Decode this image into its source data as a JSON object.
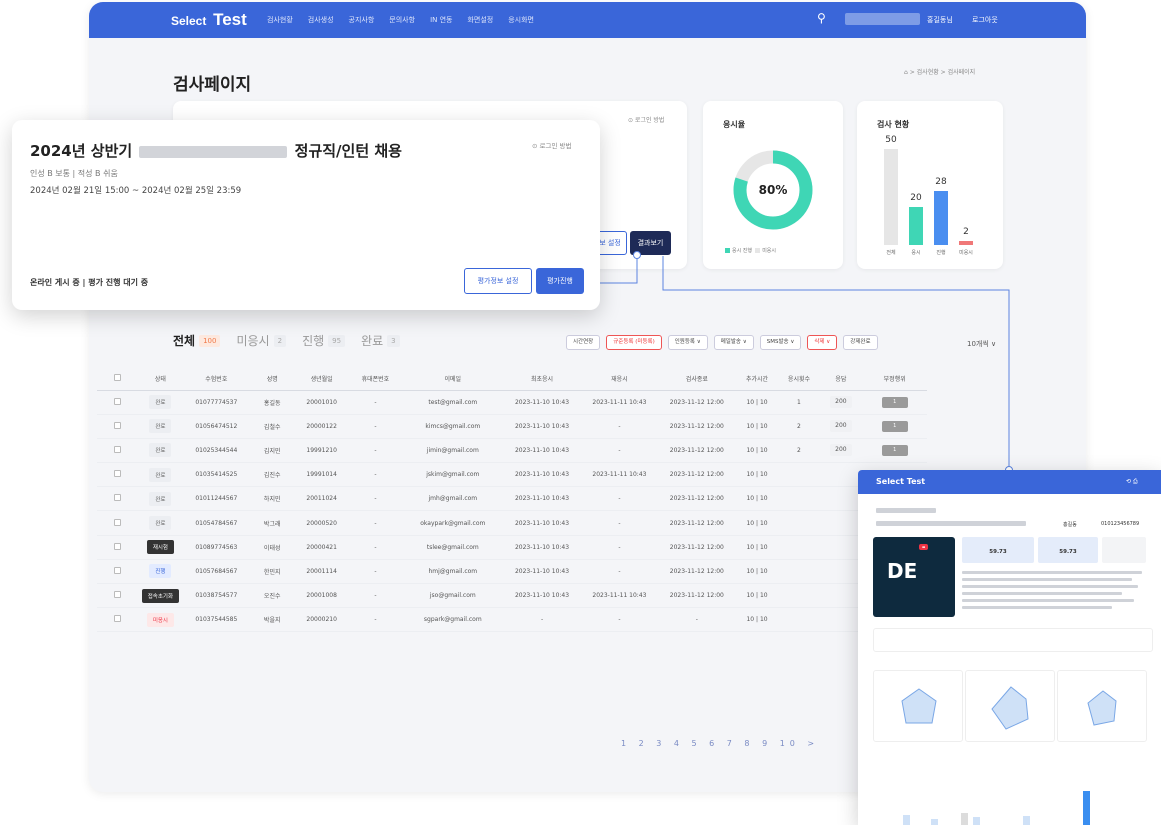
{
  "nav": {
    "brand_select": "Select",
    "brand_test": "Test",
    "menu": [
      "검사현황",
      "검사생성",
      "공지사항",
      "문의사항",
      "IN 연동",
      "화면설정",
      "응시화면"
    ],
    "user": "홍길동님",
    "logout": "로그아웃"
  },
  "page": {
    "title": "검사페이지",
    "breadcrumb": "⌂ > 검사현황 > 검사페이지"
  },
  "back_card": {
    "login_method": "⊙ 로그인 방법",
    "setting": "보 설정",
    "result": "결과보기"
  },
  "rate_card": {
    "title": "응시율",
    "percent": "80%",
    "legend_done": "응시 진행",
    "legend_not": "미응시",
    "value": 80
  },
  "status_card": {
    "title": "검사 현황"
  },
  "chart_data": {
    "type": "bar",
    "categories": [
      "전체",
      "응시",
      "진행",
      "미응시"
    ],
    "values": [
      50,
      20,
      28,
      2
    ],
    "colors": [
      "#e6e6e6",
      "#3fd6b5",
      "#4a8ef0",
      "#f07878"
    ]
  },
  "float_card": {
    "title_prefix": "2024년 상반기",
    "title_suffix": "정규직/인턴 채용",
    "login_method": "⊙ 로그인 방법",
    "sub": "인성 B 보통 | 적성 B 쉬움",
    "date": "2024년 02월 21일 15:00 ~ 2024년 02월 25일 23:59",
    "status": "온라인 게시 중 | 평가 진행 대기 중",
    "btn_info": "평가정보 설정",
    "btn_run": "평가진행"
  },
  "tabs": [
    {
      "label": "전체",
      "count": "100"
    },
    {
      "label": "미응시",
      "count": "2"
    },
    {
      "label": "진행",
      "count": "95"
    },
    {
      "label": "완료",
      "count": "3"
    }
  ],
  "toolbar": [
    "시간연장",
    "규준등록 (미등록)",
    "인원등록 ∨",
    "메일발송 ∨",
    "SMS발송 ∨",
    "삭제 ∨",
    "강제완료"
  ],
  "per_page": "10개씩 ∨",
  "table": {
    "headers": [
      "",
      "상태",
      "수험번호",
      "성명",
      "생년월일",
      "휴대폰번호",
      "이메일",
      "최초응시",
      "재응시",
      "검사종료",
      "추가시간",
      "응시횟수",
      "응답",
      "부정행위"
    ],
    "rows": [
      [
        "완료",
        "01077774537",
        "홍길동",
        "20001010",
        "-",
        "test@gmail.com",
        "2023-11-10 10:43",
        "2023-11-11 10:43",
        "2023-11-12 12:00",
        "10 | 10",
        "1",
        "200",
        "1"
      ],
      [
        "완료",
        "01056474512",
        "김철수",
        "20000122",
        "-",
        "kimcs@gmail.com",
        "2023-11-10 10:43",
        "-",
        "2023-11-12 12:00",
        "10 | 10",
        "2",
        "200",
        "1"
      ],
      [
        "완료",
        "01025344544",
        "김지민",
        "19991210",
        "-",
        "jimin@gmail.com",
        "2023-11-10 10:43",
        "-",
        "2023-11-12 12:00",
        "10 | 10",
        "2",
        "200",
        "1"
      ],
      [
        "완료",
        "01035414525",
        "김진수",
        "19991014",
        "-",
        "jskim@gmail.com",
        "2023-11-10 10:43",
        "2023-11-11 10:43",
        "2023-11-12 12:00",
        "10 | 10",
        "",
        "",
        ""
      ],
      [
        "완료",
        "01011244567",
        "하지민",
        "20011024",
        "-",
        "jmh@gmail.com",
        "2023-11-10 10:43",
        "-",
        "2023-11-12 12:00",
        "10 | 10",
        "",
        "",
        ""
      ],
      [
        "완료",
        "01054784567",
        "박그래",
        "20000520",
        "-",
        "okaypark@gmail.com",
        "2023-11-10 10:43",
        "-",
        "2023-11-12 12:00",
        "10 | 10",
        "",
        "",
        ""
      ],
      [
        "재시험",
        "01089774563",
        "이태성",
        "20000421",
        "-",
        "tslee@gmail.com",
        "2023-11-10 10:43",
        "-",
        "2023-11-12 12:00",
        "10 | 10",
        "",
        "",
        ""
      ],
      [
        "진행",
        "01057684567",
        "한민지",
        "20001114",
        "-",
        "hmj@gmail.com",
        "2023-11-10 10:43",
        "-",
        "2023-11-12 12:00",
        "10 | 10",
        "",
        "",
        ""
      ],
      [
        "접속초기화",
        "01038754577",
        "오진수",
        "20001008",
        "-",
        "jso@gmail.com",
        "2023-11-10 10:43",
        "2023-11-11 10:43",
        "2023-11-12 12:00",
        "10 | 10",
        "",
        "",
        ""
      ],
      [
        "미응시",
        "01037544585",
        "박을지",
        "20000210",
        "-",
        "sgpark@gmail.com",
        "-",
        "-",
        "-",
        "10 | 10",
        "",
        "",
        ""
      ]
    ]
  },
  "pager": "1 2 3 4 5 6 7 8 9 10 >",
  "report": {
    "brand": "Select Test",
    "name": "홍길동",
    "phone": "010123456789",
    "type": "DE",
    "score1": "59.73",
    "score2": "59.73"
  }
}
